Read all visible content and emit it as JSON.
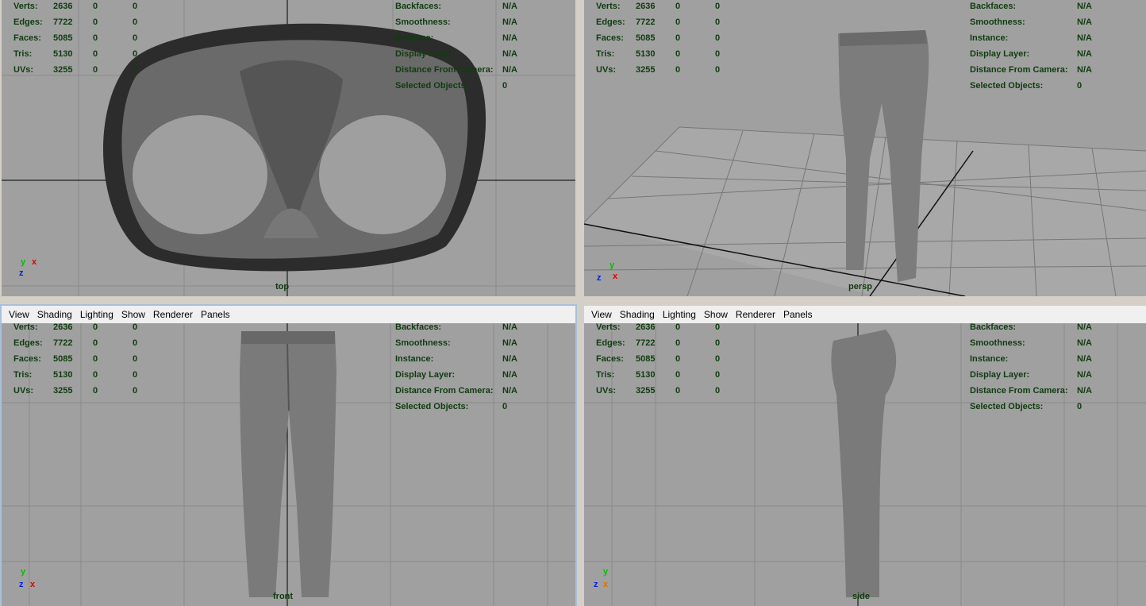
{
  "menu": [
    "View",
    "Shading",
    "Lighting",
    "Show",
    "Renderer",
    "Panels"
  ],
  "stats": {
    "rows": [
      {
        "label": "Verts:",
        "a": "2636",
        "b": "0",
        "c": "0"
      },
      {
        "label": "Edges:",
        "a": "7722",
        "b": "0",
        "c": "0"
      },
      {
        "label": "Faces:",
        "a": "5085",
        "b": "0",
        "c": "0"
      },
      {
        "label": "Tris:",
        "a": "5130",
        "b": "0",
        "c": "0"
      },
      {
        "label": "UVs:",
        "a": "3255",
        "b": "0",
        "c": "0"
      }
    ],
    "info": [
      {
        "label": "Backfaces:",
        "value": "N/A"
      },
      {
        "label": "Smoothness:",
        "value": "N/A"
      },
      {
        "label": "Instance:",
        "value": "N/A"
      },
      {
        "label": "Display Layer:",
        "value": "N/A"
      },
      {
        "label": "Distance From Camera:",
        "value": "N/A"
      },
      {
        "label": "Selected Objects:",
        "value": "0"
      }
    ]
  },
  "panels": {
    "top": {
      "label": "top"
    },
    "persp": {
      "label": "persp"
    },
    "front": {
      "label": "front"
    },
    "side": {
      "label": "side"
    }
  },
  "axis": {
    "x": "x",
    "y": "y",
    "z": "z"
  },
  "colors": {
    "hud": "#103c10",
    "viewport_bg": "#a0a0a0",
    "grid": "#8a8a8a",
    "axis_x": "#e00000",
    "axis_y": "#00c000",
    "axis_z": "#0020e0"
  }
}
